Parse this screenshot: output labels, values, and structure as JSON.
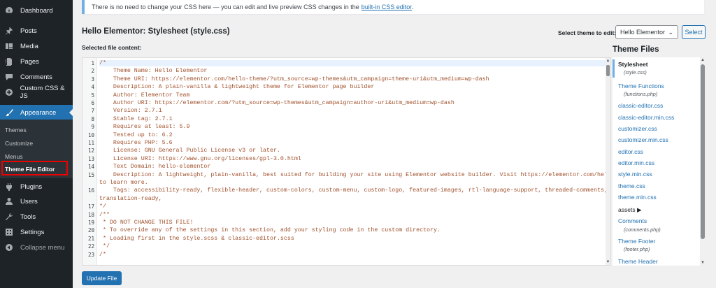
{
  "sidebar": {
    "items": [
      {
        "label": "Dashboard",
        "icon": "dashboard-icon"
      },
      {
        "label": "Posts",
        "icon": "pin-icon"
      },
      {
        "label": "Media",
        "icon": "media-icon"
      },
      {
        "label": "Pages",
        "icon": "pages-icon"
      },
      {
        "label": "Comments",
        "icon": "comments-icon"
      },
      {
        "label": "Custom CSS & JS",
        "icon": "plus-circle-icon"
      },
      {
        "label": "Appearance",
        "icon": "brush-icon"
      },
      {
        "label": "Plugins",
        "icon": "plugin-icon"
      },
      {
        "label": "Users",
        "icon": "user-icon"
      },
      {
        "label": "Tools",
        "icon": "wrench-icon"
      },
      {
        "label": "Settings",
        "icon": "settings-icon"
      },
      {
        "label": "Collapse menu",
        "icon": "collapse-icon"
      }
    ],
    "submenu": [
      "Themes",
      "Customize",
      "Menus",
      "Theme File Editor"
    ]
  },
  "notice": {
    "text": "There is no need to change your CSS here — you can edit and live preview CSS changes in the",
    "link": "built-in CSS editor",
    "suffix": "."
  },
  "header": {
    "title": "Hello Elementor: Stylesheet (style.css)",
    "select_label": "Select theme to edit:",
    "selected_theme": "Hello Elementor",
    "select_button": "Select",
    "selected_file_label": "Selected file content:"
  },
  "editor": {
    "lines": [
      {
        "n": "1",
        "t": "/*"
      },
      {
        "n": "2",
        "t": "    Theme Name: Hello Elementor"
      },
      {
        "n": "3",
        "t": "    Theme URI: https://elementor.com/hello-theme/?utm_source=wp-themes&utm_campaign=theme-uri&utm_medium=wp-dash"
      },
      {
        "n": "4",
        "t": "    Description: A plain-vanilla & lightweight theme for Elementor page builder"
      },
      {
        "n": "5",
        "t": "    Author: Elementor Team"
      },
      {
        "n": "6",
        "t": "    Author URI: https://elementor.com/?utm_source=wp-themes&utm_campaign=author-uri&utm_medium=wp-dash"
      },
      {
        "n": "7",
        "t": "    Version: 2.7.1"
      },
      {
        "n": "8",
        "t": "    Stable tag: 2.7.1"
      },
      {
        "n": "9",
        "t": "    Requires at least: 5.9"
      },
      {
        "n": "10",
        "t": "    Tested up to: 6.2"
      },
      {
        "n": "11",
        "t": "    Requires PHP: 5.6"
      },
      {
        "n": "12",
        "t": "    License: GNU General Public License v3 or later."
      },
      {
        "n": "13",
        "t": "    License URI: https://www.gnu.org/licenses/gpl-3.0.html"
      },
      {
        "n": "14",
        "t": "    Text Domain: hello-elementor"
      },
      {
        "n": "15",
        "t": "    Description: A lightweight, plain-vanilla, best suited for building your site using Elementor website builder. Visit https://elementor.com/hello-theme/"
      },
      {
        "n": "",
        "t": "to learn more."
      },
      {
        "n": "16",
        "t": "    Tags: accessibility-ready, flexible-header, custom-colors, custom-menu, custom-logo, featured-images, rtl-language-support, threaded-comments,"
      },
      {
        "n": "",
        "t": "translation-ready,"
      },
      {
        "n": "17",
        "t": "*/"
      },
      {
        "n": "18",
        "t": "/**"
      },
      {
        "n": "19",
        "t": " * DO NOT CHANGE THIS FILE!"
      },
      {
        "n": "20",
        "t": " * To override any of the settings in this section, add your styling code in the custom directory."
      },
      {
        "n": "21",
        "t": " * Loading first in the style.scss & classic-editor.scss"
      },
      {
        "n": "22",
        "t": " */"
      },
      {
        "n": "23",
        "t": "/*"
      }
    ]
  },
  "theme_files": {
    "title": "Theme Files",
    "stylesheet": "Stylesheet",
    "stylesheet_sub": "(style.css)",
    "functions": "Theme Functions",
    "functions_sub": "(functions.php)",
    "files": [
      "classic-editor.css",
      "classic-editor.min.css",
      "customizer.css",
      "customizer.min.css",
      "editor.css",
      "editor.min.css",
      "style.min.css",
      "theme.css",
      "theme.min.css"
    ],
    "assets": "assets",
    "comments": "Comments",
    "comments_sub": "(comments.php)",
    "footer": "Theme Footer",
    "footer_sub": "(footer.php)",
    "header": "Theme Header"
  },
  "update_button": "Update File",
  "colors": {
    "sidebar_bg": "#1d2327",
    "accent": "#2271b1",
    "code": "#a0522d",
    "highlight_box": "#e00000"
  }
}
